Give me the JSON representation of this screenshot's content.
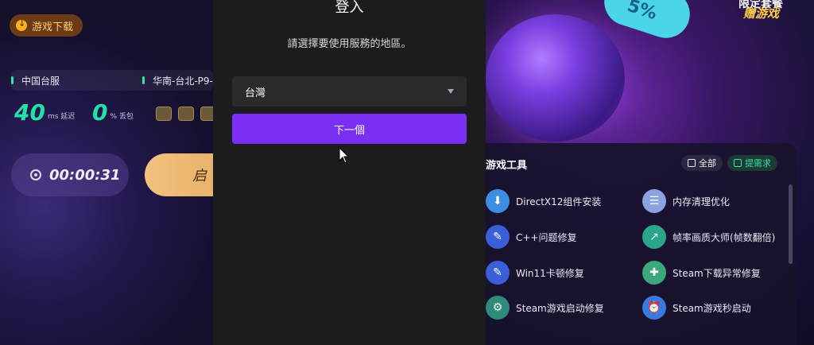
{
  "left_app": {
    "download_badge": "游戏下载",
    "server_left": "中国台服",
    "server_right": "华南-台北-P9-",
    "latency_value": "40",
    "latency_unit": "ms 延迟",
    "loss_value": "0",
    "loss_unit": "% 丢包",
    "timer": "00:00:31",
    "start_label": "启"
  },
  "promo": {
    "tag": "5%",
    "line1": "限定套餐",
    "line2": "赠游戏"
  },
  "tools": {
    "title": "游戏工具",
    "all_chip": "全部",
    "request_chip": "提需求",
    "items": [
      {
        "label": "DirectX12组件安装",
        "icon": "download-box-icon",
        "color": "#3d8de0"
      },
      {
        "label": "内存清理优化",
        "icon": "memory-list-icon",
        "color": "#8aa2e0"
      },
      {
        "label": "C++问题修复",
        "icon": "wrench-icon",
        "color": "#3b5fd8"
      },
      {
        "label": "帧率画质大师(帧数翻倍)",
        "icon": "frame-boost-icon",
        "color": "#2aa58a"
      },
      {
        "label": "Win11卡顿修复",
        "icon": "wrench-icon",
        "color": "#3b5fd8"
      },
      {
        "label": "Steam下载异常修复",
        "icon": "file-repair-icon",
        "color": "#3aa878"
      },
      {
        "label": "Steam游戏启动修复",
        "icon": "steam-repair-icon",
        "color": "#2f8a7a"
      },
      {
        "label": "Steam游戏秒启动",
        "icon": "alarm-clock-icon",
        "color": "#3a7ae0"
      }
    ]
  },
  "login_modal": {
    "title": "登入",
    "subtitle": "請選擇要使用服務的地區。",
    "region_value": "台灣",
    "next_button": "下一個"
  }
}
